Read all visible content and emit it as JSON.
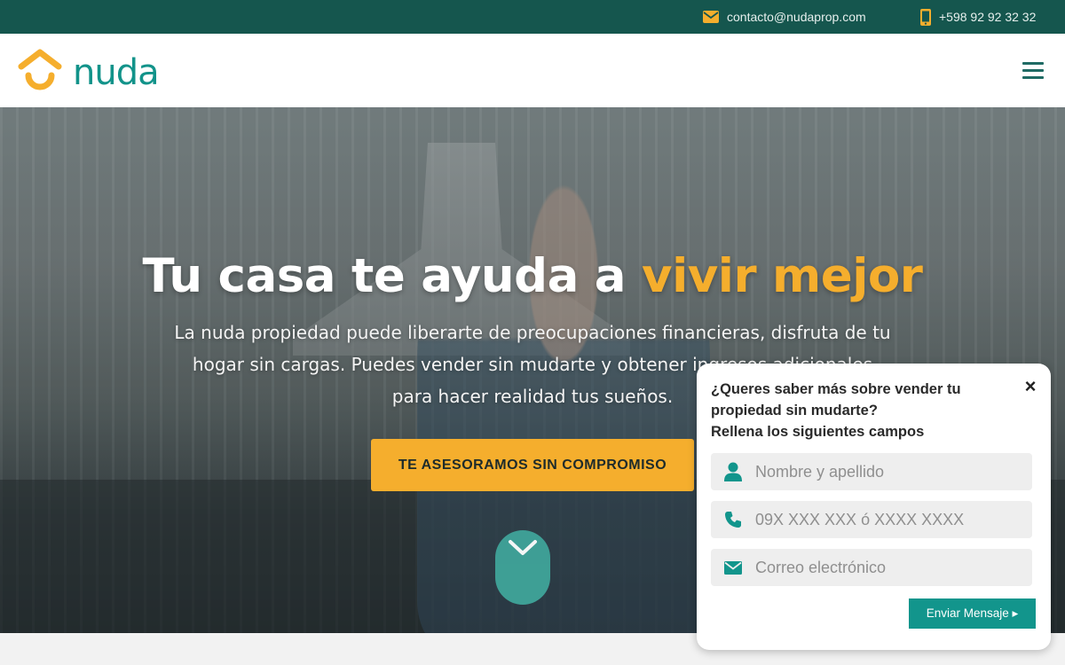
{
  "topbar": {
    "email": "contacto@nudaprop.com",
    "phone": "+598 92 92 32 32"
  },
  "header": {
    "logo_text": "nuda"
  },
  "hero": {
    "title_main": "Tu casa te ayuda a ",
    "title_accent": "vivir mejor",
    "subtitle": "La nuda propiedad puede liberarte de preocupaciones financieras, disfruta de tu hogar sin cargas. Puedes vender sin mudarte y obtener ingresos adicionales para hacer realidad tus sueños.",
    "cta_label": "TE ASESORAMOS SIN COMPROMISO"
  },
  "popup": {
    "close": "×",
    "title_line1": "¿Queres saber más sobre vender tu propiedad sin mudarte?",
    "title_line2": "Rellena los siguientes campos",
    "fields": [
      {
        "placeholder": "Nombre y apellido",
        "icon": "user-icon"
      },
      {
        "placeholder": "09X XXX XXX ó XXXX XXXX",
        "icon": "phone-icon"
      },
      {
        "placeholder": "Correo electrónico",
        "icon": "envelope-icon"
      }
    ],
    "submit_label": "Enviar Mensaje ▸"
  },
  "colors": {
    "topbar": "#15564e",
    "brand_teal": "#12938a",
    "accent_orange": "#f5ae2d"
  }
}
